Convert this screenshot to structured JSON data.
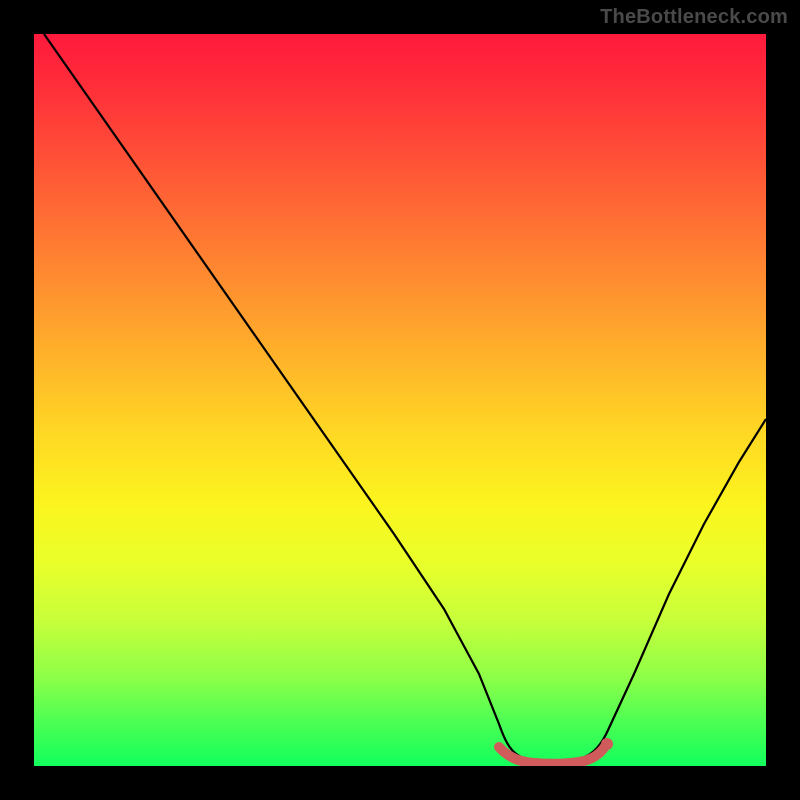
{
  "watermark": {
    "text": "TheBottleneck.com"
  },
  "chart_data": {
    "type": "line",
    "title": "",
    "xlabel": "",
    "ylabel": "",
    "xlim": [
      0,
      100
    ],
    "ylim": [
      0,
      100
    ],
    "series": [
      {
        "name": "bottleneck-curve",
        "x": [
          0,
          5,
          10,
          15,
          20,
          25,
          30,
          35,
          40,
          45,
          50,
          55,
          60,
          62,
          64,
          66,
          68,
          70,
          72,
          74,
          76,
          80,
          85,
          90,
          95,
          100
        ],
        "y": [
          100,
          92,
          84,
          76,
          68,
          60,
          52,
          44,
          36,
          28,
          20,
          12,
          4,
          1.5,
          0.8,
          0.6,
          0.6,
          0.6,
          0.8,
          1.5,
          4,
          12,
          22,
          32,
          40,
          46
        ]
      },
      {
        "name": "optimal-range-marker",
        "x": [
          62,
          64,
          66,
          68,
          70,
          72,
          74
        ],
        "y": [
          1.5,
          0.8,
          0.6,
          0.6,
          0.6,
          0.8,
          1.5
        ]
      }
    ],
    "colors": {
      "curve": "#000000",
      "marker": "#cf5b5b",
      "gradient_top": "#ff1a3c",
      "gradient_mid": "#ffd624",
      "gradient_bottom": "#12ff5c"
    }
  }
}
